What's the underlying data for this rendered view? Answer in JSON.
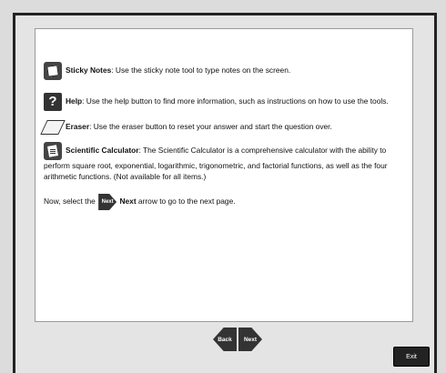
{
  "content": {
    "sticky": {
      "title": "Sticky Notes",
      "text": ": Use the sticky note tool to type notes on the screen."
    },
    "help": {
      "title": "Help",
      "text": ": Use the help button to find more information, such as instructions on how to use the tools."
    },
    "eraser": {
      "title": "Eraser",
      "text": ": Use the eraser button to reset your answer and start the question over."
    },
    "calculator": {
      "title": "Scientific Calculator",
      "text": ": The Scientific Calculator is a comprehensive calculator with the ability to perform square root, exponential, logarithmic, trigonometric, and factorial functions, as well as the four arithmetic functions. (Not available for all items.)"
    },
    "next_instruction": {
      "prefix": "Now, select the ",
      "icon_label": "Next",
      "bold": "Next",
      "suffix": " arrow to go to the next page."
    }
  },
  "nav": {
    "back_label": "Back",
    "next_label": "Next"
  },
  "exit_label": "Exit",
  "icons": [
    "sticky-note-icon",
    "help-icon",
    "eraser-icon",
    "calculator-icon",
    "next-arrow-icon"
  ]
}
